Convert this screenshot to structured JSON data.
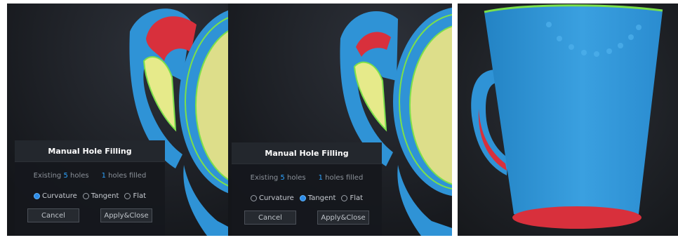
{
  "panels": [
    {
      "dialog": {
        "title": "Manual Hole Filling",
        "existing_prefix": "Existing ",
        "existing_count": "5",
        "existing_suffix": " holes",
        "filled_count": "1",
        "filled_suffix": " holes filled",
        "modes": [
          {
            "label": "Curvature",
            "selected": true
          },
          {
            "label": "Tangent",
            "selected": false
          },
          {
            "label": "Flat",
            "selected": false
          }
        ],
        "cancel_label": "Cancel",
        "apply_label": "Apply&Close"
      }
    },
    {
      "dialog": {
        "title": "Manual Hole Filling",
        "existing_prefix": "Existing ",
        "existing_count": "5",
        "existing_suffix": " holes",
        "filled_count": "1",
        "filled_suffix": " holes filled",
        "modes": [
          {
            "label": "Curvature",
            "selected": false
          },
          {
            "label": "Tangent",
            "selected": true
          },
          {
            "label": "Flat",
            "selected": false
          }
        ],
        "cancel_label": "Cancel",
        "apply_label": "Apply&Close"
      }
    }
  ],
  "colors": {
    "background": "#1a1d22",
    "mesh_blue": "#2f93d6",
    "filled_red": "#d8303c",
    "interior_yellow": "#e6ea8a",
    "edge_green": "#7be04a",
    "accent": "#2ea4ff"
  }
}
